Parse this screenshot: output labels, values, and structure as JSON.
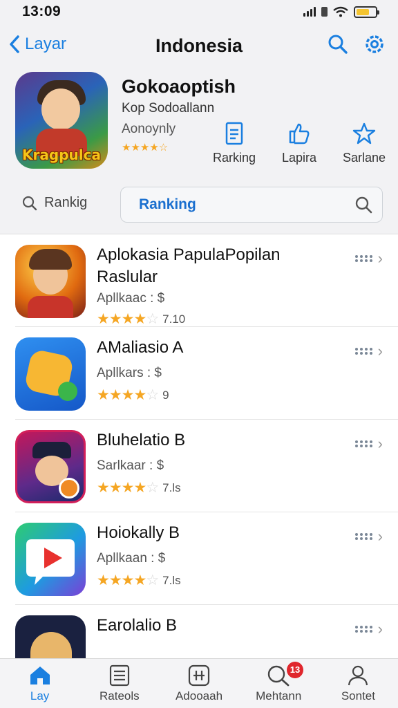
{
  "status": {
    "time": "13:09"
  },
  "nav": {
    "back_label": "Layar",
    "title": "Indonesia"
  },
  "hero": {
    "icon_text": "Kragpulca",
    "title": "Gokoaoptish",
    "developer": "Kop Sodoallann",
    "category": "Aonoynly",
    "stars": "★★★★☆",
    "actions": [
      {
        "label": "Rarking",
        "icon": "document-icon"
      },
      {
        "label": "Lapira",
        "icon": "share-icon"
      },
      {
        "label": "Sarlane",
        "icon": "star-icon"
      }
    ]
  },
  "search": {
    "left_label": "Rankig",
    "value": "Ranking"
  },
  "apps": [
    {
      "title": "Aplokasia PapulaPopilan Raslular",
      "subtitle": "Apllkaac : $",
      "stars_on": 3,
      "stars_half": 1,
      "rating": "7.10"
    },
    {
      "title": "AMaliasio A",
      "subtitle": "Apllkars : $",
      "stars_on": 4,
      "stars_half": 0,
      "rating": "9"
    },
    {
      "title": "Bluhelatio B",
      "subtitle": "Sarlkaar : $",
      "stars_on": 3,
      "stars_half": 1,
      "rating": "7.ls"
    },
    {
      "title": "Hoiokally B",
      "subtitle": "Apllkaan : $",
      "stars_on": 3,
      "stars_half": 1,
      "rating": "7.ls"
    },
    {
      "title": "Earolalio B",
      "subtitle": "",
      "stars_on": 0,
      "stars_half": 0,
      "rating": ""
    }
  ],
  "tabs": [
    {
      "label": "Lay",
      "icon": "home-icon",
      "active": true
    },
    {
      "label": "Rateols",
      "icon": "list-icon",
      "active": false
    },
    {
      "label": "Adooaah",
      "icon": "grid-icon",
      "active": false
    },
    {
      "label": "Mehtann",
      "icon": "search-icon",
      "active": false,
      "badge": "13"
    },
    {
      "label": "Sontet",
      "icon": "person-icon",
      "active": false
    }
  ],
  "colors": {
    "accent": "#1a7fe0",
    "star": "#f5a623",
    "badge": "#e0262d"
  }
}
